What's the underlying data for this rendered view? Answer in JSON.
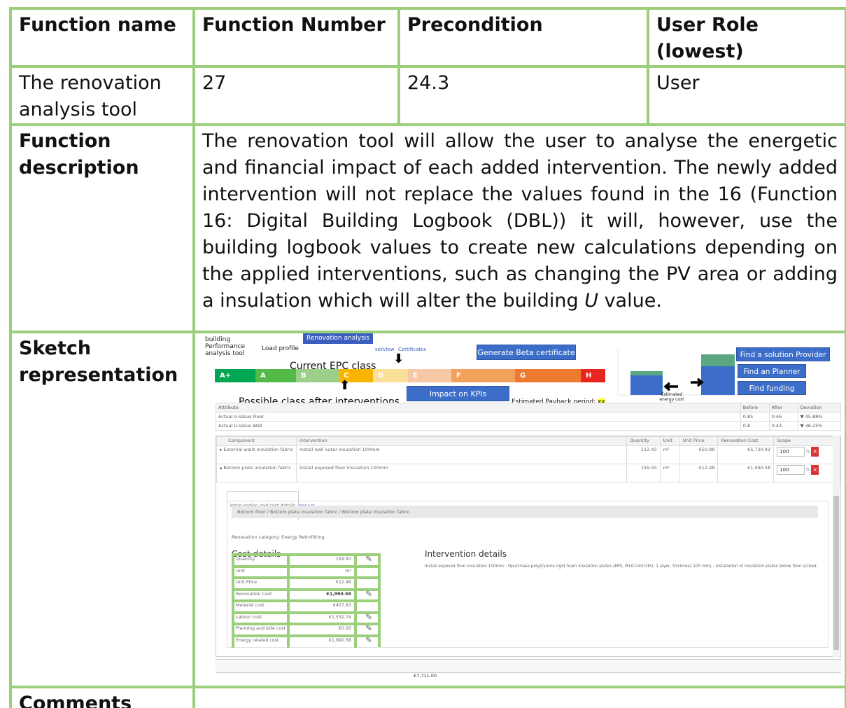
{
  "header": {
    "col1": "Function name",
    "col2": "Function Number",
    "col3": "Precondition",
    "col4": "User Role (lowest)"
  },
  "row1": {
    "name": "The renovation analysis tool",
    "number": "27",
    "precondition": "24.3",
    "role": "User"
  },
  "description": {
    "label": "Function description",
    "text_before_u": "The renovation tool will allow the user to analyse the energetic and financial impact of each added intervention. The newly added intervention will not replace the values found in the 16 (Function 16: Digital Building Logbook (DBL)) it will, however, use the building logbook values to create new calculations depending on the applied interventions, such as changing the PV area or adding a insulation which will alter the building ",
    "u_letter": "U",
    "text_after_u": " value."
  },
  "sketch": {
    "label": "Sketch representation",
    "tabs": {
      "building": "building Performance analysis tool",
      "load_profile": "Load profile",
      "renovation": "Renovation analysis",
      "view": "setView",
      "certificates": "Certificates"
    },
    "current_epc_label": "Current  EPC class",
    "possible_label": "Possible class after interventions",
    "epc_classes": [
      {
        "label": "A+",
        "color": "#00a651"
      },
      {
        "label": "A",
        "color": "#53b947"
      },
      {
        "label": "B",
        "color": "#9cd08a"
      },
      {
        "label": "C",
        "color": "#f7b500"
      },
      {
        "label": "D",
        "color": "#fbe09a"
      },
      {
        "label": "E",
        "color": "#f7c8a6"
      },
      {
        "label": "F",
        "color": "#f4a15e"
      },
      {
        "label": "G",
        "color": "#ee7a30"
      },
      {
        "label": "H",
        "color": "#e8251e"
      }
    ],
    "generate_beta": "Generate Beta certificate",
    "impact_kpis": "Impact on KPIs",
    "payback_label": "Estimated Payback period: ",
    "payback_value": "xx Years",
    "chart_caption": "Estimated energy cost after interventions",
    "find_provider": "Find a solution Provider",
    "find_planner": "Find an Planner",
    "find_funding": "Find funding",
    "attr_headers": [
      "Attribute",
      "Before",
      "After",
      "Deviation"
    ],
    "attr_rows": [
      {
        "attribute": "Actual U-Value Floor",
        "before": "0.85",
        "after": "0.46",
        "deviation": "▼ 45.88%"
      },
      {
        "attribute": "Actual U-Value Wall",
        "before": "0.8",
        "after": "0.43",
        "deviation": "▼ 46.25%"
      }
    ],
    "comp_headers": [
      "Component",
      "Intervention",
      "Quantity",
      "Unit",
      "Unit Price",
      "Renovation Cost",
      "Scope"
    ],
    "comp_rows": [
      {
        "toggle": "▸",
        "component": "External walls insulation fabric",
        "intervention": "Install wall outer insulation 100mm",
        "quantity": "112.43",
        "unit": "m²",
        "unit_price": "€50.88",
        "cost": "€5,720.42",
        "scope": "100",
        "pct": "%",
        "del": "×"
      },
      {
        "toggle": "▴",
        "component": "Bottom plate insulation fabric",
        "intervention": "Install exposed floor insulation 100mm",
        "quantity": "159.50",
        "unit": "m²",
        "unit_price": "€12.48",
        "cost": "€1,990.58",
        "scope": "100",
        "pct": "%",
        "del": "×"
      }
    ],
    "subtab_details": "Intervention and cost details",
    "subtab_impact": "Impact",
    "breadcrumb": "Bottom floor  /  Bottom plate insulation fabric  /  Bottom plate insulation fabric",
    "renovation_category": "Renovation category: Energy Retrofitting",
    "cost_details_title": "Cost details",
    "intervention_details_title": "Intervention details",
    "intervention_details_text": "Install exposed floor insulation 100mm - Opurchase polystyrene rigid-foam insulation plates (EPS, WLG 040 DEO, 1 layer, thickness 100 mm) - installation of insulation plates below floor screed",
    "cost_rows": [
      {
        "label": "Quantity",
        "value": "159.50",
        "edit": true
      },
      {
        "label": "Unit",
        "value": "m²",
        "edit": false
      },
      {
        "label": "Unit Price",
        "value": "€12.48",
        "edit": false
      },
      {
        "label": "Renovation Cost",
        "value": "€1,990.58",
        "edit": true
      },
      {
        "label": "Material cost",
        "value": "€457.83",
        "edit": false
      },
      {
        "label": "Labour cost",
        "value": "€1,532.74",
        "edit": true
      },
      {
        "label": "Planning and side cost",
        "value": "€0.00",
        "edit": true
      },
      {
        "label": "Energy related cost",
        "value": "€1,990.58",
        "edit": true
      }
    ],
    "footer_total": "€7,711.00"
  },
  "comments": {
    "label": "Comments"
  },
  "colors": {
    "table_border": "#9ccf7c",
    "button_blue": "#3c6ec9",
    "tab_active": "#3c5fbf",
    "delete_red": "#d93535",
    "highlight": "#ffff33"
  }
}
